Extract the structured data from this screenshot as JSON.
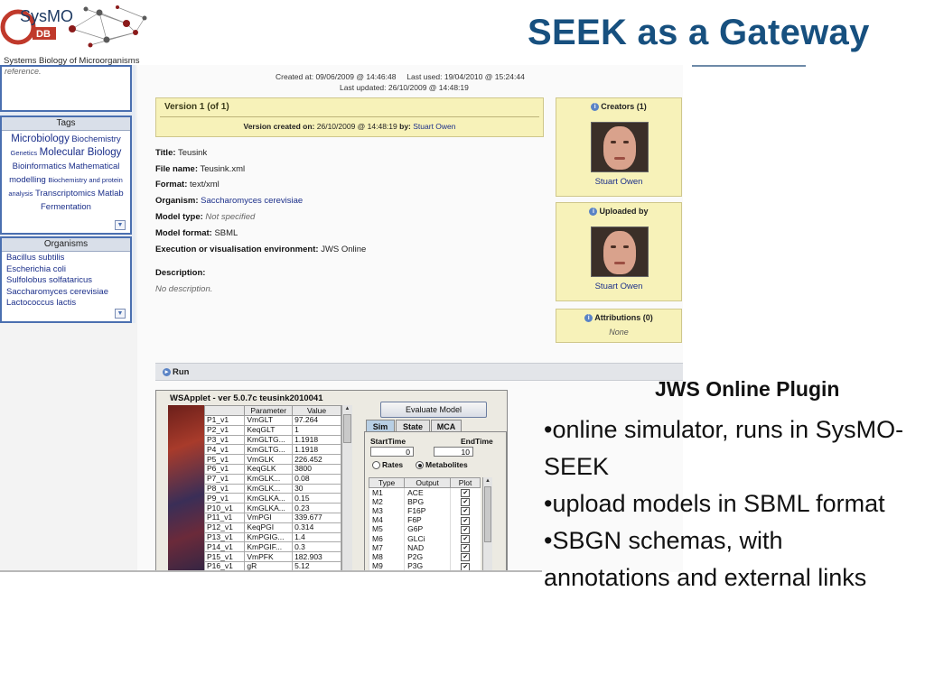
{
  "slide": {
    "title": "SEEK as a Gateway",
    "logo": {
      "name_sys": "SysMO",
      "name_db": "DB",
      "subtitle": "Systems Biology of Microorganisms"
    }
  },
  "sidebar": {
    "reference_text": "reference.",
    "tags": {
      "header": "Tags",
      "items": [
        {
          "label": "Microbiology",
          "size": "lg"
        },
        {
          "label": "Biochemistry",
          "size": "md"
        },
        {
          "label": "Genetics",
          "size": "sm"
        },
        {
          "label": "Molecular Biology",
          "size": "lg"
        },
        {
          "label": "Bioinformatics",
          "size": "md"
        },
        {
          "label": "Mathematical modelling",
          "size": "md"
        },
        {
          "label": "Biochemistry and protein analysis",
          "size": "sm"
        },
        {
          "label": "Transcriptomics",
          "size": "md"
        },
        {
          "label": "Matlab",
          "size": "md"
        },
        {
          "label": "Fermentation",
          "size": "md"
        }
      ]
    },
    "organisms": {
      "header": "Organisms",
      "items": [
        "Bacillus subtilis",
        "Escherichia coli",
        "Sulfolobus solfataricus",
        "Saccharomyces cerevisiae",
        "Lactococcus lactis"
      ]
    }
  },
  "meta": {
    "created_label": "Created at:",
    "created_value": "09/06/2009 @ 14:46:48",
    "last_used_label": "Last used:",
    "last_used_value": "19/04/2010 @ 15:24:44",
    "last_updated_label": "Last updated:",
    "last_updated_value": "26/10/2009 @ 14:48:19"
  },
  "version": {
    "title": "Version 1 (of 1)",
    "created_label": "Version created on:",
    "created_value": "26/10/2009 @ 14:48:19",
    "by_label": "by:",
    "by_value": "Stuart Owen"
  },
  "model": {
    "title_label": "Title:",
    "title_value": "Teusink",
    "file_label": "File name:",
    "file_value": "Teusink.xml",
    "format_label": "Format:",
    "format_value": "text/xml",
    "organism_label": "Organism:",
    "organism_value": "Saccharomyces cerevisiae",
    "model_type_label": "Model type:",
    "model_type_value": "Not specified",
    "model_format_label": "Model format:",
    "model_format_value": "SBML",
    "env_label": "Execution or visualisation environment:",
    "env_value": "JWS Online",
    "description_label": "Description:",
    "description_value": "No description."
  },
  "cards": {
    "creators": {
      "title": "Creators (1)",
      "name": "Stuart Owen"
    },
    "uploaded": {
      "title": "Uploaded by",
      "name": "Stuart Owen"
    },
    "attributions": {
      "title": "Attributions (0)",
      "value": "None"
    }
  },
  "run": {
    "label": "Run"
  },
  "applet": {
    "title": "WSApplet - ver 5.0.7c   teusink2010041",
    "param_headers": [
      "",
      "Parameter",
      "Value"
    ],
    "params": [
      [
        "P1_v1",
        "VmGLT",
        "97.264"
      ],
      [
        "P2_v1",
        "KeqGLT",
        "1"
      ],
      [
        "P3_v1",
        "KmGLTG...",
        "1.1918"
      ],
      [
        "P4_v1",
        "KmGLTG...",
        "1.1918"
      ],
      [
        "P5_v1",
        "VmGLK",
        "226.452"
      ],
      [
        "P6_v1",
        "KeqGLK",
        "3800"
      ],
      [
        "P7_v1",
        "KmGLK...",
        "0.08"
      ],
      [
        "P8_v1",
        "KmGLK...",
        "30"
      ],
      [
        "P9_v1",
        "KmGLKA...",
        "0.15"
      ],
      [
        "P10_v1",
        "KmGLKA...",
        "0.23"
      ],
      [
        "P11_v1",
        "VmPGI",
        "339.677"
      ],
      [
        "P12_v1",
        "KeqPGI",
        "0.314"
      ],
      [
        "P13_v1",
        "KmPGIG...",
        "1.4"
      ],
      [
        "P14_v1",
        "KmPGIF...",
        "0.3"
      ],
      [
        "P15_v1",
        "VmPFK",
        "182.903"
      ],
      [
        "P16_v1",
        "gR",
        "5.12"
      ]
    ],
    "evaluate_label": "Evaluate Model",
    "tabs": [
      "Sim",
      "State",
      "MCA"
    ],
    "start_label": "StartTime",
    "end_label": "EndTime",
    "start_value": "0",
    "end_value": "10",
    "rates_label": "Rates",
    "metabolites_label": "Metabolites",
    "metab_headers": [
      "Type",
      "Output",
      "Plot"
    ],
    "metabolites": [
      [
        "M1",
        "ACE"
      ],
      [
        "M2",
        "BPG"
      ],
      [
        "M3",
        "F16P"
      ],
      [
        "M4",
        "F6P"
      ],
      [
        "M5",
        "G6P"
      ],
      [
        "M6",
        "GLCi"
      ],
      [
        "M7",
        "NAD"
      ],
      [
        "M8",
        "P2G"
      ],
      [
        "M9",
        "P3G"
      ]
    ],
    "checkmark": "✔"
  },
  "plugin": {
    "title": "JWS Online Plugin",
    "bullets": [
      "•online simulator, runs in SysMO-SEEK",
      "•upload models in SBML format",
      "•SBGN schemas, with annotations and external links"
    ]
  },
  "colors": {
    "title": "#17507f",
    "card": "#f7f2b9",
    "link": "#1b2f8a",
    "sidebar_border": "#4a6fb0"
  }
}
